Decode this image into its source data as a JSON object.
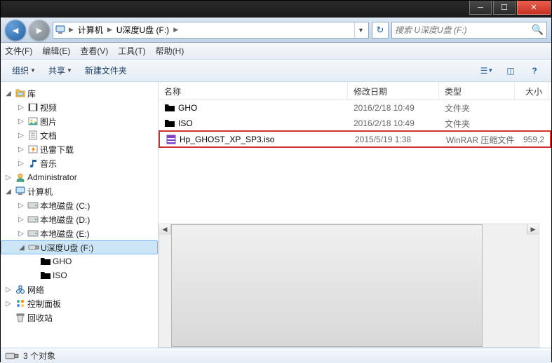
{
  "breadcrumb": {
    "root": "计算机",
    "drive": "U深度U盘 (F:)"
  },
  "search": {
    "placeholder": "搜索 U深度U盘 (F:)"
  },
  "menubar": {
    "file": "文件(F)",
    "edit": "编辑(E)",
    "view": "查看(V)",
    "tools": "工具(T)",
    "help": "帮助(H)"
  },
  "toolbar": {
    "organize": "组织",
    "share": "共享",
    "newfolder": "新建文件夹"
  },
  "columns": {
    "name": "名称",
    "date": "修改日期",
    "type": "类型",
    "size": "大小"
  },
  "tree": {
    "libraries": {
      "label": "库"
    },
    "lib_items": {
      "video": "视频",
      "picture": "图片",
      "document": "文档",
      "thunder": "迅雷下载",
      "music": "音乐"
    },
    "admin": "Administrator",
    "computer": "计算机",
    "drives": {
      "c": "本地磁盘 (C:)",
      "d": "本地磁盘 (D:)",
      "e": "本地磁盘 (E:)",
      "f": "U深度U盘 (F:)"
    },
    "f_children": {
      "gho": "GHO",
      "iso": "ISO"
    },
    "network": "网络",
    "controlpanel": "控制面板",
    "recyclebin": "回收站"
  },
  "files": [
    {
      "name": "GHO",
      "date": "2016/2/18 10:49",
      "type": "文件夹",
      "size": "",
      "icon": "folder"
    },
    {
      "name": "ISO",
      "date": "2016/2/18 10:49",
      "type": "文件夹",
      "size": "",
      "icon": "folder"
    },
    {
      "name": "Hp_GHOST_XP_SP3.iso",
      "date": "2015/5/19 1:38",
      "type": "WinRAR 压缩文件",
      "size": "959,2",
      "icon": "rar",
      "highlight": true
    }
  ],
  "status": {
    "count": "3 个对象"
  }
}
